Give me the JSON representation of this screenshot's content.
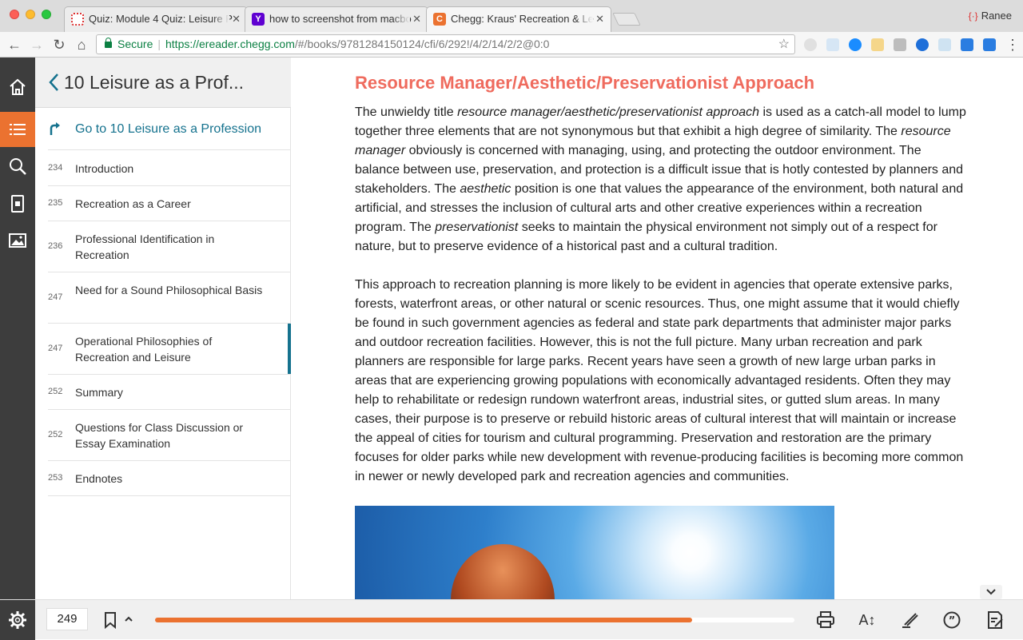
{
  "browser": {
    "tabs": [
      {
        "title": "Quiz: Module 4 Quiz: Leisure P",
        "active": false
      },
      {
        "title": "how to screenshot from macbo",
        "active": false
      },
      {
        "title": "Chegg: Kraus' Recreation & Le",
        "active": true
      }
    ],
    "profile_name": "Ranee",
    "secure_label": "Secure",
    "url_host": "https://ereader.chegg.com",
    "url_path": "/#/books/9781284150124/cfi/6/292!/4/2/14/2/2@0:0"
  },
  "sidebar": {
    "title": "10 Leisure as a Prof...",
    "goto_label": "Go to 10 Leisure as a Profession",
    "items": [
      {
        "page": "234",
        "label": "Introduction"
      },
      {
        "page": "235",
        "label": "Recreation as a Career"
      },
      {
        "page": "236",
        "label": "Professional Identification in Recreation"
      },
      {
        "page": "247",
        "label": "Need for a Sound Philosophical Basis"
      },
      {
        "page": "247",
        "label": "Operational Philosophies of Recreation and Leisure"
      },
      {
        "page": "252",
        "label": "Summary"
      },
      {
        "page": "252",
        "label": "Questions for Class Discussion or Essay Examination"
      },
      {
        "page": "253",
        "label": "Endnotes"
      }
    ]
  },
  "content": {
    "heading": "Resource Manager/Aesthetic/Preservationist Approach",
    "p1": [
      {
        "t": "The unwieldy title ",
        "i": false
      },
      {
        "t": "resource manager/aesthetic/preservationist approach",
        "i": true
      },
      {
        "t": " is used as a catch-all model to lump together three elements that are not synonymous but that exhibit a high degree of similarity. The ",
        "i": false
      },
      {
        "t": "resource manager",
        "i": true
      },
      {
        "t": " obviously is concerned with managing, using, and protecting the outdoor environment. The balance between use, preservation, and protection is a difficult issue that is hotly contested by planners and stakeholders. The ",
        "i": false
      },
      {
        "t": "aesthetic",
        "i": true
      },
      {
        "t": " position is one that values the appearance of the environment, both natural and artificial, and stresses the inclusion of cultural arts and other creative experiences within a recreation program. The ",
        "i": false
      },
      {
        "t": "preservationist",
        "i": true
      },
      {
        "t": " seeks to maintain the physical environment not simply out of a respect for nature, but to preserve evidence of a historical past and a cultural tradition.",
        "i": false
      }
    ],
    "p2": "This approach to recreation planning is more likely to be evident in agencies that operate extensive parks, forests, waterfront areas, or other natural or scenic resources. Thus, one might assume that it would chiefly be found in such government agencies as federal and state park departments that administer major parks and outdoor recreation facilities. However, this is not the full picture. Many urban recreation and park planners are responsible for large parks. Recent years have seen a growth of new large urban parks in areas that are experiencing growing populations with economically advantaged residents. Often they may help to rehabilitate or redesign rundown waterfront areas, industrial sites, or gutted slum areas. In many cases, their purpose is to preserve or rebuild historic areas of cultural interest that will maintain or increase the appeal of cities for tourism and cultural programming. Preservation and restoration are the primary focuses for older parks while new development with revenue-producing facilities is becoming more common in newer or newly developed park and recreation agencies and communities."
  },
  "bottombar": {
    "page_number": "249",
    "progress": 0.84
  },
  "colors": {
    "accent": "#eb7230",
    "heading": "#ef6b5e",
    "link": "#15728e",
    "rail": "#3d3d3d"
  },
  "icons": [
    "home-icon",
    "toc-icon",
    "search-icon",
    "flashcards-icon",
    "image-icon",
    "settings-icon",
    "bookmark-icon",
    "print-icon",
    "text-size-icon",
    "highlight-icon",
    "quote-icon",
    "notes-icon"
  ]
}
